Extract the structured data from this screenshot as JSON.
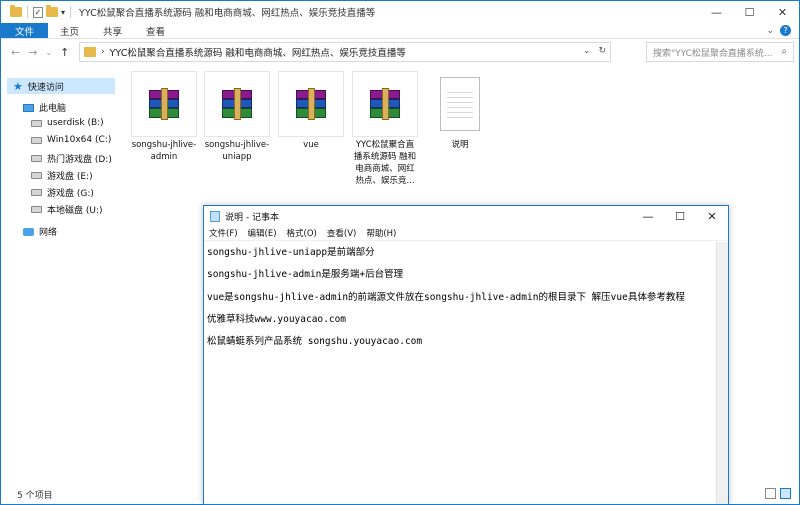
{
  "explorer": {
    "title": "YYC松鼠聚合直播系统源码  融和电商商城、网红热点、娱乐竞技直播等",
    "ribbon_tabs": [
      "文件",
      "主页",
      "共享",
      "查看"
    ],
    "address": "YYC松鼠聚合直播系统源码  融和电商商城、网红热点、娱乐竞技直播等",
    "search_placeholder": "搜索\"YYC松鼠聚合直播系统...",
    "status": "5 个项目"
  },
  "sidebar": {
    "quick_access": "快速访问",
    "this_pc": "此电脑",
    "drives": [
      "userdisk (B:)",
      "Win10x64 (C:)",
      "热门游戏盘 (D:)",
      "游戏盘 (E:)",
      "游戏盘 (G:)",
      "本地磁盘 (U:)"
    ],
    "network": "网络"
  },
  "files": [
    {
      "name": "songshu-jhlive-admin",
      "icon": "winrar-archive-icon"
    },
    {
      "name": "songshu-jhlive-uniapp",
      "icon": "winrar-archive-icon"
    },
    {
      "name": "vue",
      "icon": "winrar-archive-icon"
    },
    {
      "name": "YYC松鼠聚合直播系统源码  融和电商商城、网红热点、娱乐竞...",
      "icon": "winrar-archive-icon"
    },
    {
      "name": "说明",
      "icon": "text-document-icon"
    }
  ],
  "notepad": {
    "title": "说明 - 记事本",
    "menu": [
      "文件(F)",
      "编辑(E)",
      "格式(O)",
      "查看(V)",
      "帮助(H)"
    ],
    "lines": [
      "songshu-jhlive-uniapp是前端部分",
      "songshu-jhlive-admin是服务端+后台管理",
      "vue是songshu-jhlive-admin的前端源文件放在songshu-jhlive-admin的根目录下 解压vue具体参考教程",
      "优雅草科技www.youyacao.com",
      "松鼠蜻蜓系列产品系统 songshu.youyacao.com"
    ]
  },
  "colors": {
    "accent": "#1979ca",
    "selection": "#cce8ff",
    "folder": "#e8b94a"
  }
}
